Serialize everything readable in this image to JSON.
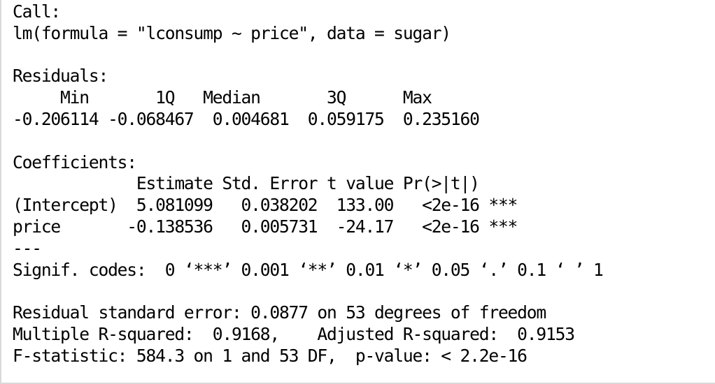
{
  "output": {
    "call_header": "Call:",
    "call_formula": "lm(formula = \"lconsump ~ price\", data = sugar)",
    "residuals_header": "Residuals:",
    "residuals_labels": "     Min       1Q   Median       3Q      Max ",
    "residuals_values": "-0.206114 -0.068467  0.004681  0.059175  0.235160 ",
    "coefficients_header": "Coefficients:",
    "coef_columns": "             Estimate Std. Error t value Pr(>|t|)    ",
    "coef_intercept": "(Intercept)  5.081099   0.038202  133.00   <2e-16 ***",
    "coef_price": "price       -0.138536   0.005731  -24.17   <2e-16 ***",
    "separator": "---",
    "signif_codes": "Signif. codes:  0 ‘***’ 0.001 ‘**’ 0.01 ‘*’ 0.05 ‘.’ 0.1 ‘ ’ 1",
    "residual_se": "Residual standard error: 0.0877 on 53 degrees of freedom",
    "r_squared": "Multiple R-squared:  0.9168,\tAdjusted R-squared:  0.9153 ",
    "f_statistic": "F-statistic: 584.3 on 1 and 53 DF,  p-value: < 2.2e-16"
  }
}
